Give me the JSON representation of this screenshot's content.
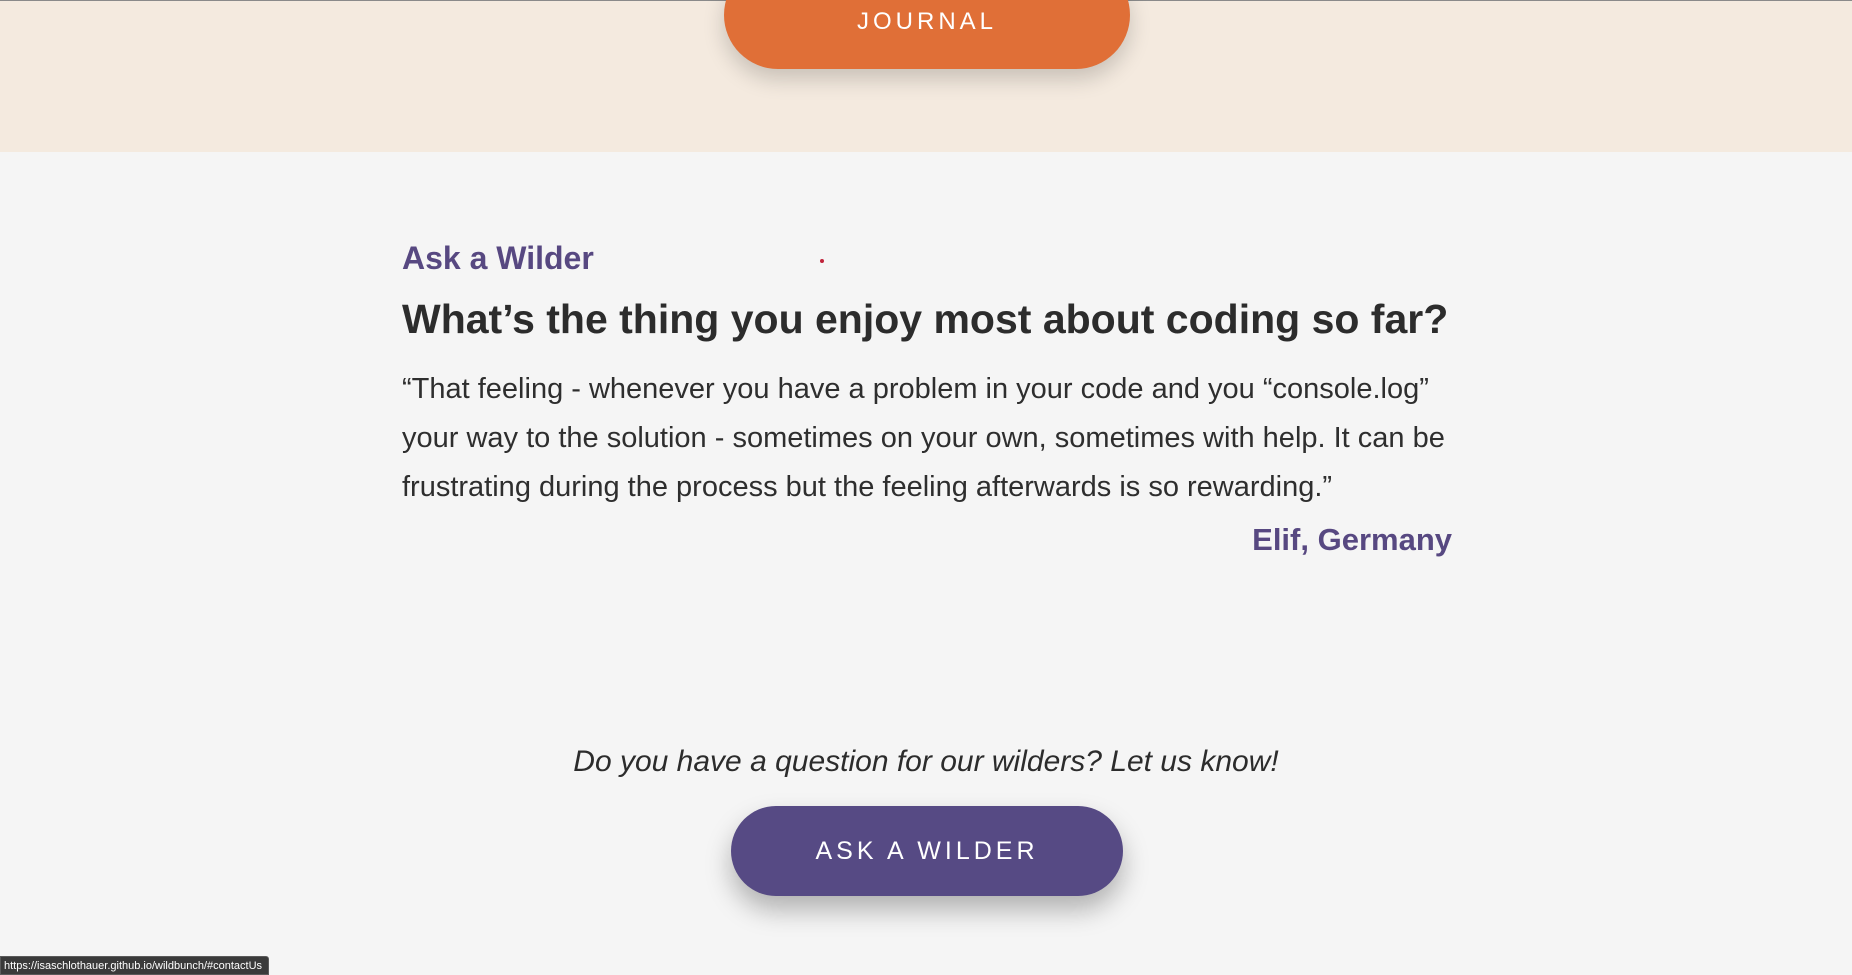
{
  "header": {
    "journal_button_label": "JOURNAL"
  },
  "ask_a_wilder": {
    "kicker": "Ask a Wilder",
    "question": "What’s the thing you enjoy most about coding so far?",
    "quote": "“That feeling - whenever you have a problem in your code and you “console.log” your way to the solution - sometimes on your own, sometimes with help. It can be frustrating during the process but the feeling afterwards is so rewarding.”",
    "author": "Elif, Germany"
  },
  "cta": {
    "prompt": "Do you have a question for our wilders? Let us know!",
    "button_label": "ASK A WILDER"
  },
  "status_bar": {
    "url": "https://isaschlothauer.github.io/wildbunch/#contactUs"
  },
  "colors": {
    "accent_orange": "#e06f37",
    "accent_purple": "#564a84",
    "top_band": "#f4eadf",
    "page_background": "#f5f5f5"
  }
}
